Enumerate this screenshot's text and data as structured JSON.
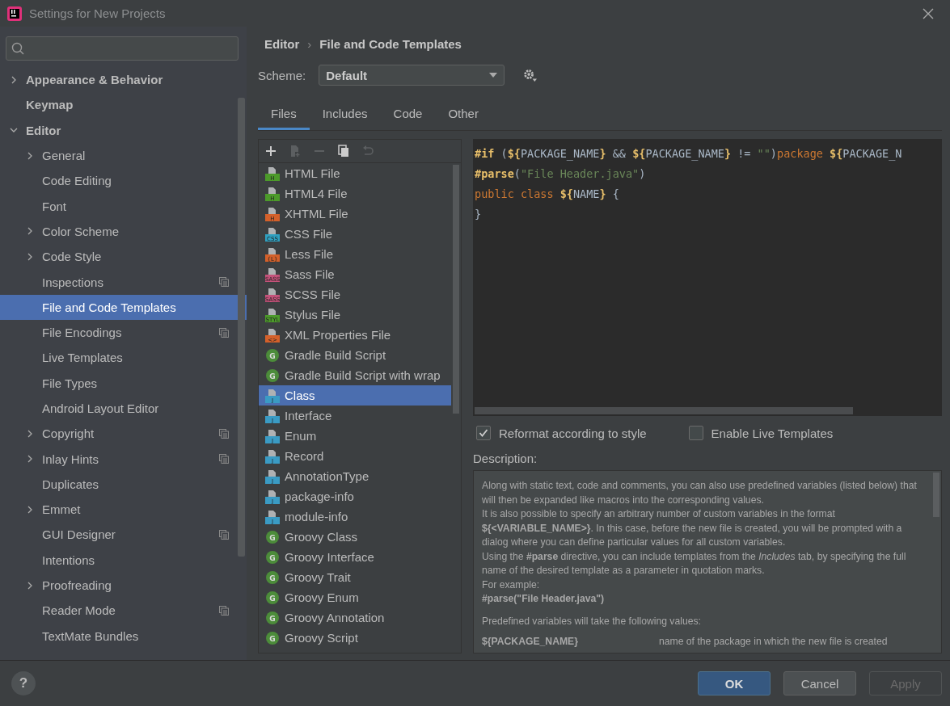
{
  "window": {
    "title": "Settings for New Projects"
  },
  "sidebar": {
    "items": [
      {
        "label": "Appearance & Behavior",
        "expanded": false,
        "selected": false
      },
      {
        "label": "Keymap",
        "selected": false
      },
      {
        "label": "Editor",
        "expanded": true,
        "selected": false,
        "children": [
          {
            "label": "General",
            "expanded": false,
            "selected": false
          },
          {
            "label": "Code Editing",
            "selected": false
          },
          {
            "label": "Font",
            "selected": false
          },
          {
            "label": "Color Scheme",
            "expanded": false,
            "selected": false
          },
          {
            "label": "Code Style",
            "expanded": false,
            "selected": false
          },
          {
            "label": "Inspections",
            "selected": false,
            "project_scope": true
          },
          {
            "label": "File and Code Templates",
            "selected": true
          },
          {
            "label": "File Encodings",
            "selected": false,
            "project_scope": true
          },
          {
            "label": "Live Templates",
            "selected": false
          },
          {
            "label": "File Types",
            "selected": false
          },
          {
            "label": "Android Layout Editor",
            "selected": false
          },
          {
            "label": "Copyright",
            "expanded": false,
            "selected": false,
            "project_scope": true
          },
          {
            "label": "Inlay Hints",
            "expanded": false,
            "selected": false,
            "project_scope": true
          },
          {
            "label": "Duplicates",
            "selected": false
          },
          {
            "label": "Emmet",
            "expanded": false,
            "selected": false
          },
          {
            "label": "GUI Designer",
            "selected": false,
            "project_scope": true
          },
          {
            "label": "Intentions",
            "selected": false
          },
          {
            "label": "Proofreading",
            "expanded": false,
            "selected": false
          },
          {
            "label": "Reader Mode",
            "selected": false,
            "project_scope": true
          },
          {
            "label": "TextMate Bundles",
            "selected": false
          }
        ]
      }
    ]
  },
  "breadcrumb": [
    "Editor",
    "›",
    "File and Code Templates"
  ],
  "scheme": {
    "label": "Scheme:",
    "value": "Default"
  },
  "tabs": [
    {
      "label": "Files",
      "selected": true
    },
    {
      "label": "Includes",
      "selected": false
    },
    {
      "label": "Code",
      "selected": false
    },
    {
      "label": "Other",
      "selected": false
    }
  ],
  "toolbar": [
    {
      "kind": "add",
      "disabled": false
    },
    {
      "kind": "add-child",
      "disabled": true
    },
    {
      "kind": "remove",
      "disabled": true
    },
    {
      "kind": "copy",
      "disabled": false
    },
    {
      "kind": "reset",
      "disabled": true
    }
  ],
  "templates": [
    {
      "label": "HTML File",
      "kind": "file",
      "badge": "H",
      "color": "#4c9a2a",
      "selected": false
    },
    {
      "label": "HTML4 File",
      "kind": "file",
      "badge": "H",
      "color": "#4c9a2a",
      "selected": false
    },
    {
      "label": "XHTML File",
      "kind": "file",
      "badge": "H",
      "color": "#d4602a",
      "selected": false
    },
    {
      "label": "CSS File",
      "kind": "file",
      "badge": "CSS",
      "color": "#2fa0c0",
      "selected": false
    },
    {
      "label": "Less File",
      "kind": "file",
      "badge": "{L}",
      "color": "#d4602a",
      "selected": false
    },
    {
      "label": "Sass File",
      "kind": "file",
      "badge": "SASS",
      "color": "#c4527a",
      "selected": false
    },
    {
      "label": "SCSS File",
      "kind": "file",
      "badge": "SASS",
      "color": "#c4527a",
      "selected": false
    },
    {
      "label": "Stylus File",
      "kind": "file",
      "badge": "STYL",
      "color": "#4c9a2a",
      "selected": false
    },
    {
      "label": "XML Properties File",
      "kind": "file",
      "badge": "<>",
      "color": "#d4602a",
      "selected": false
    },
    {
      "label": "Gradle Build Script",
      "kind": "circle",
      "badge": "G",
      "color": "#4c8c3a",
      "selected": false
    },
    {
      "label": "Gradle Build Script with wrap",
      "kind": "circle",
      "badge": "G",
      "color": "#4c8c3a",
      "selected": false
    },
    {
      "label": "Class",
      "kind": "file",
      "badge": "J",
      "color": "#3a9bc4",
      "selected": true
    },
    {
      "label": "Interface",
      "kind": "file",
      "badge": "J",
      "color": "#3a9bc4",
      "selected": false
    },
    {
      "label": "Enum",
      "kind": "file",
      "badge": "J",
      "color": "#3a9bc4",
      "selected": false
    },
    {
      "label": "Record",
      "kind": "file",
      "badge": "J",
      "color": "#3a9bc4",
      "selected": false
    },
    {
      "label": "AnnotationType",
      "kind": "file",
      "badge": "J",
      "color": "#3a9bc4",
      "selected": false
    },
    {
      "label": "package-info",
      "kind": "file",
      "badge": "J",
      "color": "#3a9bc4",
      "selected": false
    },
    {
      "label": "module-info",
      "kind": "file",
      "badge": "J",
      "color": "#3a9bc4",
      "selected": false
    },
    {
      "label": "Groovy Class",
      "kind": "circle",
      "badge": "G",
      "color": "#4c8c3a",
      "selected": false
    },
    {
      "label": "Groovy Interface",
      "kind": "circle",
      "badge": "G",
      "color": "#4c8c3a",
      "selected": false
    },
    {
      "label": "Groovy Trait",
      "kind": "circle",
      "badge": "G",
      "color": "#4c8c3a",
      "selected": false
    },
    {
      "label": "Groovy Enum",
      "kind": "circle",
      "badge": "G",
      "color": "#4c8c3a",
      "selected": false
    },
    {
      "label": "Groovy Annotation",
      "kind": "circle",
      "badge": "G",
      "color": "#4c8c3a",
      "selected": false
    },
    {
      "label": "Groovy Script",
      "kind": "circle",
      "badge": "G",
      "color": "#4c8c3a",
      "selected": false
    }
  ],
  "code": [
    [
      {
        "kind": "directive",
        "t": "#if"
      },
      {
        "kind": "plain",
        "t": " ("
      },
      {
        "kind": "delim",
        "t": "${"
      },
      {
        "kind": "plain",
        "t": "PACKAGE_NAME"
      },
      {
        "kind": "delim",
        "t": "}"
      },
      {
        "kind": "plain",
        "t": " && "
      },
      {
        "kind": "delim",
        "t": "${"
      },
      {
        "kind": "plain",
        "t": "PACKAGE_NAME"
      },
      {
        "kind": "delim",
        "t": "}"
      },
      {
        "kind": "plain",
        "t": " != "
      },
      {
        "kind": "string",
        "t": "\"\""
      },
      {
        "kind": "plain",
        "t": ")"
      },
      {
        "kind": "keyword",
        "t": "package "
      },
      {
        "kind": "delim",
        "t": "${"
      },
      {
        "kind": "plain",
        "t": "PACKAGE_N"
      }
    ],
    [
      {
        "kind": "directive",
        "t": "#parse"
      },
      {
        "kind": "plain",
        "t": "("
      },
      {
        "kind": "string",
        "t": "\"File Header.java\""
      },
      {
        "kind": "plain",
        "t": ")"
      }
    ],
    [
      {
        "kind": "keyword",
        "t": "public class "
      },
      {
        "kind": "delim",
        "t": "${"
      },
      {
        "kind": "plain",
        "t": "NAME"
      },
      {
        "kind": "delim",
        "t": "}"
      },
      {
        "kind": "plain",
        "t": " {"
      }
    ],
    [
      {
        "kind": "plain",
        "t": "}"
      }
    ]
  ],
  "options": [
    {
      "label": "Reformat according to style",
      "checked": true
    },
    {
      "label": "Enable Live Templates",
      "checked": false
    }
  ],
  "description": {
    "label": "Description:",
    "paragraphs": [
      "Along with static text, code and comments, you can also use predefined variables (listed below) that will then be expanded like macros into the corresponding values.",
      "It is also possible to specify an arbitrary number of custom variables in the format **${<VARIABLE_NAME>}**. In this case, before the new file is created, you will be prompted with a dialog where you can define particular values for all custom variables.",
      "Using the **#parse** directive, you can include templates from the *Includes* tab, by specifying the full name of the desired template as a parameter in quotation marks.",
      "For example:",
      "**#parse(\"File Header.java\")**"
    ],
    "after": "Predefined variables will take the following values:",
    "variables": [
      {
        "name": "${PACKAGE_NAME}",
        "text": "name of the package in which the new file is created"
      }
    ]
  },
  "help": "?",
  "buttons": [
    {
      "label": "OK",
      "kind": "primary",
      "disabled": false
    },
    {
      "label": "Cancel",
      "kind": "normal",
      "disabled": false
    },
    {
      "label": "Apply",
      "kind": "normal",
      "disabled": true
    }
  ]
}
